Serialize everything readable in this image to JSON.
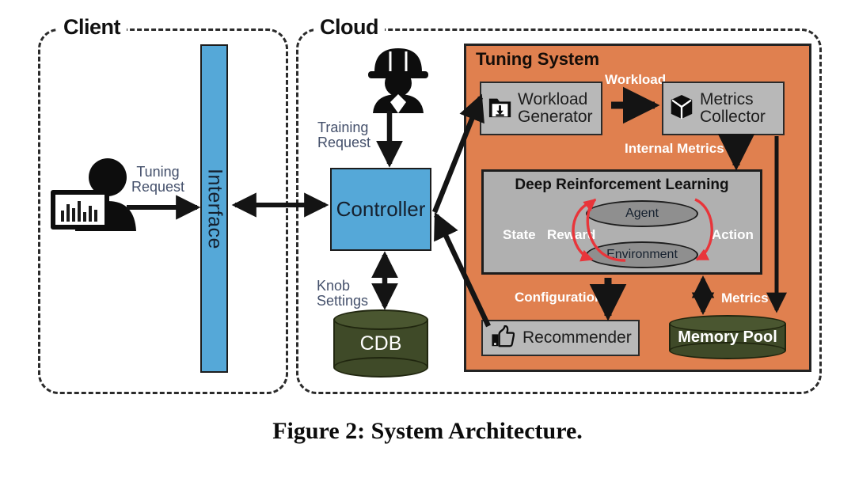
{
  "caption": "Figure 2: System Architecture.",
  "regions": [
    {
      "name": "client",
      "label": "Client"
    },
    {
      "name": "cloud",
      "label": "Cloud"
    }
  ],
  "client": {
    "title": "Client",
    "user_icon": "user-at-monitor-icon",
    "interface": {
      "label": "Interface"
    },
    "edges": {
      "tuning_request": "Tuning\nRequest",
      "tuning_request_line1": "Tuning",
      "tuning_request_line2": "Request"
    }
  },
  "cloud": {
    "title": "Cloud",
    "dba_icon": "hardhat-worker-icon",
    "controller": {
      "label": "Controller"
    },
    "cdb": {
      "label": "CDB"
    },
    "edges": {
      "training_request_line1": "Training",
      "training_request_line2": "Request",
      "knob_settings_line1": "Knob",
      "knob_settings_line2": "Settings"
    }
  },
  "tuning_system": {
    "title": "Tuning System",
    "workload_generator": {
      "line1": "Workload",
      "line2": "Generator",
      "icon": "folder-download-icon"
    },
    "metrics_collector": {
      "line1": "Metrics",
      "line2": "Collector",
      "icon": "cube-prism-icon"
    },
    "recommender": {
      "label": "Recommender",
      "icon": "thumbs-up-icon"
    },
    "memory_pool": {
      "label": "Memory Pool"
    },
    "drl": {
      "title": "Deep Reinforcement Learning",
      "agent": "Agent",
      "environment": "Environment",
      "state": "State",
      "reward": "Reward",
      "action": "Action"
    },
    "edges": {
      "workload": "Workload",
      "internal_metrics": "Internal Metrics",
      "configurations": "Configurations",
      "metrics": "Metrics"
    }
  },
  "colors": {
    "blue": "#55a8d8",
    "orange": "#e0804f",
    "gray_box": "#b8b8b8",
    "drl_gray": "#b0b0b0",
    "ellipse_gray": "#8f8f8f",
    "green": "#3f4a28",
    "red_arrow": "#e8353a",
    "label_blue": "#44506b",
    "stroke": "#1d1d1d"
  }
}
